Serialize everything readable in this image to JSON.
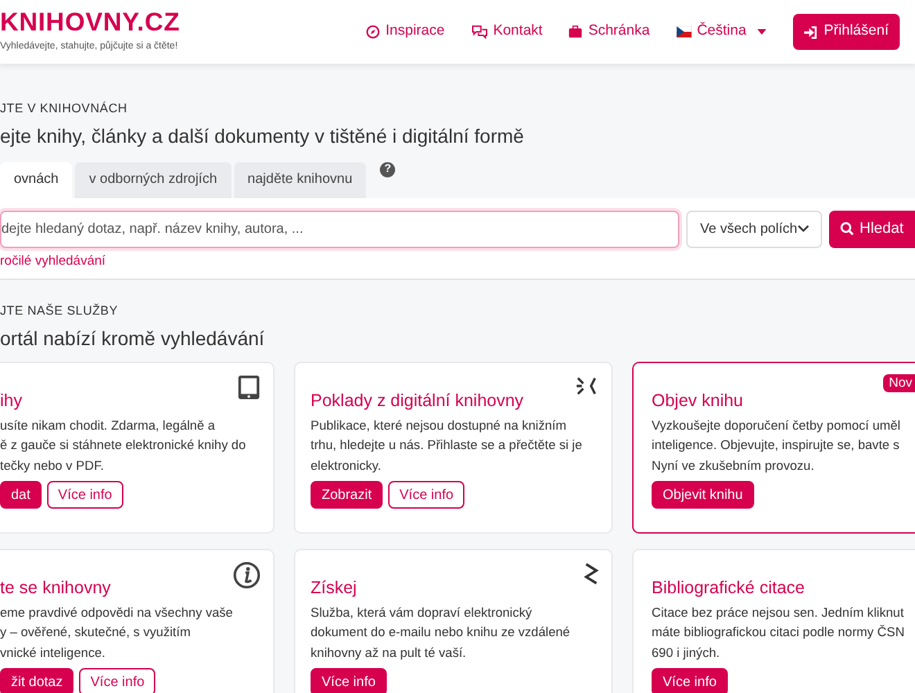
{
  "header": {
    "logo": "KNIHOVNY.CZ",
    "tagline": "Vyhledávejte, stahujte, půjčujte si a čtěte!",
    "nav": [
      {
        "label": "Inspirace"
      },
      {
        "label": "Kontakt"
      },
      {
        "label": "Schránka"
      },
      {
        "label": "Čeština"
      }
    ],
    "login": "Přihlášení"
  },
  "search": {
    "eyebrow": "JTE V KNIHOVNÁCH",
    "heading": "ejte knihy, články a další dokumenty v tištěné i digitální formě",
    "tabs": [
      {
        "label": "ovnách",
        "selected": true
      },
      {
        "label": "v odborných zdrojích",
        "selected": false
      },
      {
        "label": "najděte knihovnu",
        "selected": false
      }
    ],
    "help": "?",
    "placeholder": "dejte hledaný dotaz, např. název knihy, autora, ...",
    "field_select": "Ve všech polích",
    "button": "Hledat",
    "advanced": "ročilé vyhledávání"
  },
  "services": {
    "eyebrow": "JTE NAŠE SLUŽBY",
    "heading": "ortál nabízí kromě vyhledávání",
    "cards": [
      {
        "title": "ihy",
        "highlighted": false,
        "lines": [
          "usíte nikam chodit. Zdarma, legálně a",
          "ě z gauče si stáhnete elektronické knihy do",
          "tečky nebo v PDF."
        ],
        "buttons": [
          {
            "label": "dat",
            "kind": "primary"
          },
          {
            "label": "Více info",
            "kind": "outline"
          }
        ]
      },
      {
        "title": "Poklady z digitální knihovny",
        "highlighted": false,
        "lines": [
          "Publikace, které nejsou dostupné na knižním",
          "trhu, hledejte u nás. Přihlaste se a přečtěte si je",
          "elektronicky."
        ],
        "buttons": [
          {
            "label": "Zobrazit",
            "kind": "primary"
          },
          {
            "label": "Více info",
            "kind": "outline"
          }
        ]
      },
      {
        "title": "Objev knihu",
        "badge": "Nov",
        "highlighted": true,
        "lines": [
          "Vyzkoušejte doporučení četby pomocí uměl",
          "inteligence. Objevujte, inspirujte se, bavte s",
          "Nyní ve zkušebním provozu."
        ],
        "buttons": [
          {
            "label": "Objevit knihu",
            "kind": "primary"
          }
        ]
      },
      {
        "title": "te se knihovny",
        "highlighted": false,
        "lines": [
          "eme pravdivé odpovědi na všechny vaše",
          "y – ověřené, skutečné, s využitím",
          "vnické inteligence."
        ],
        "buttons": [
          {
            "label": "žit dotaz",
            "kind": "primary"
          },
          {
            "label": "Více info",
            "kind": "outline"
          }
        ]
      },
      {
        "title": "Získej",
        "highlighted": false,
        "lines": [
          "Služba, která vám dopraví elektronický",
          "dokument do e-mailu nebo knihu ze vzdálené",
          "knihovny až na pult té vaší."
        ],
        "buttons": [
          {
            "label": "Více info",
            "kind": "primary"
          }
        ]
      },
      {
        "title": "Bibliografické citace",
        "highlighted": false,
        "lines": [
          "Citace bez práce nejsou sen. Jedním kliknut",
          "máte bibliografickou citaci podle normy ČSN",
          "690 i jiných."
        ],
        "buttons": [
          {
            "label": "Více info",
            "kind": "primary"
          }
        ]
      }
    ]
  }
}
